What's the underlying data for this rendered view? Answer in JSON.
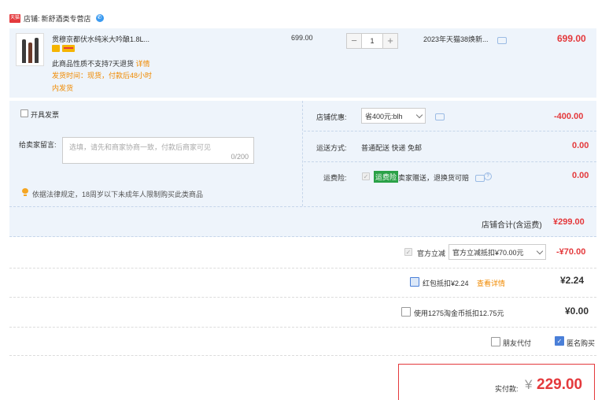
{
  "shop": {
    "tag": "天猫",
    "prefix": "店铺:",
    "name": "新舒酒类专营店"
  },
  "item": {
    "title": "贯穆京都伏水纯米大吟酿1.8L...",
    "unit_price": "699.00",
    "quantity": "1",
    "promo": "2023年天猫38焕新...",
    "subtotal": "699.00",
    "return_policy": "此商品性质不支持7天退货",
    "details_link": "详情",
    "ship_time_line1": "发货时间：现货，付款后48小时",
    "ship_time_line2": "内发货"
  },
  "options": {
    "invoice_label": "开具发票",
    "message_label": "给卖家留言:",
    "message_placeholder": "选填，请先和商家协商一致，付款后商家可见",
    "message_counter": "0/200",
    "legal_notice": "依据法律规定，18周岁以下未成年人限制购买此类商品",
    "store_discount_label": "店铺优惠:",
    "store_discount_value": "省400元:blh",
    "store_discount_amount": "-400.00",
    "shipping_label": "运送方式:",
    "shipping_value": "普通配送 快递 免邮",
    "shipping_amount": "0.00",
    "insurance_label": "运费险:",
    "insurance_badge": "运费险",
    "insurance_text": "卖家赠送，退换货可赔",
    "insurance_amount": "0.00",
    "store_total_label": "店铺合计(含运费)",
    "store_total_value": "¥299.00"
  },
  "summary": {
    "direct_label": "官方立减",
    "direct_select": "官方立减抵扣¥70.00元",
    "direct_amount": "-¥70.00",
    "redpacket_label": "红包抵扣¥2.24",
    "redpacket_link": "查看详情",
    "redpacket_amount": "¥2.24",
    "coins_label": "使用1275淘金币抵扣12.75元",
    "coins_amount": "¥0.00",
    "friend_pay_label": "朋友代付",
    "anonymous_label": "匿名购买",
    "pay_label": "实付款:",
    "pay_currency": "¥",
    "pay_amount": "229.00"
  },
  "colors": {
    "accent": "#e4393c",
    "light_blue_bg": "#eef4fb",
    "orange": "#f08a00"
  }
}
